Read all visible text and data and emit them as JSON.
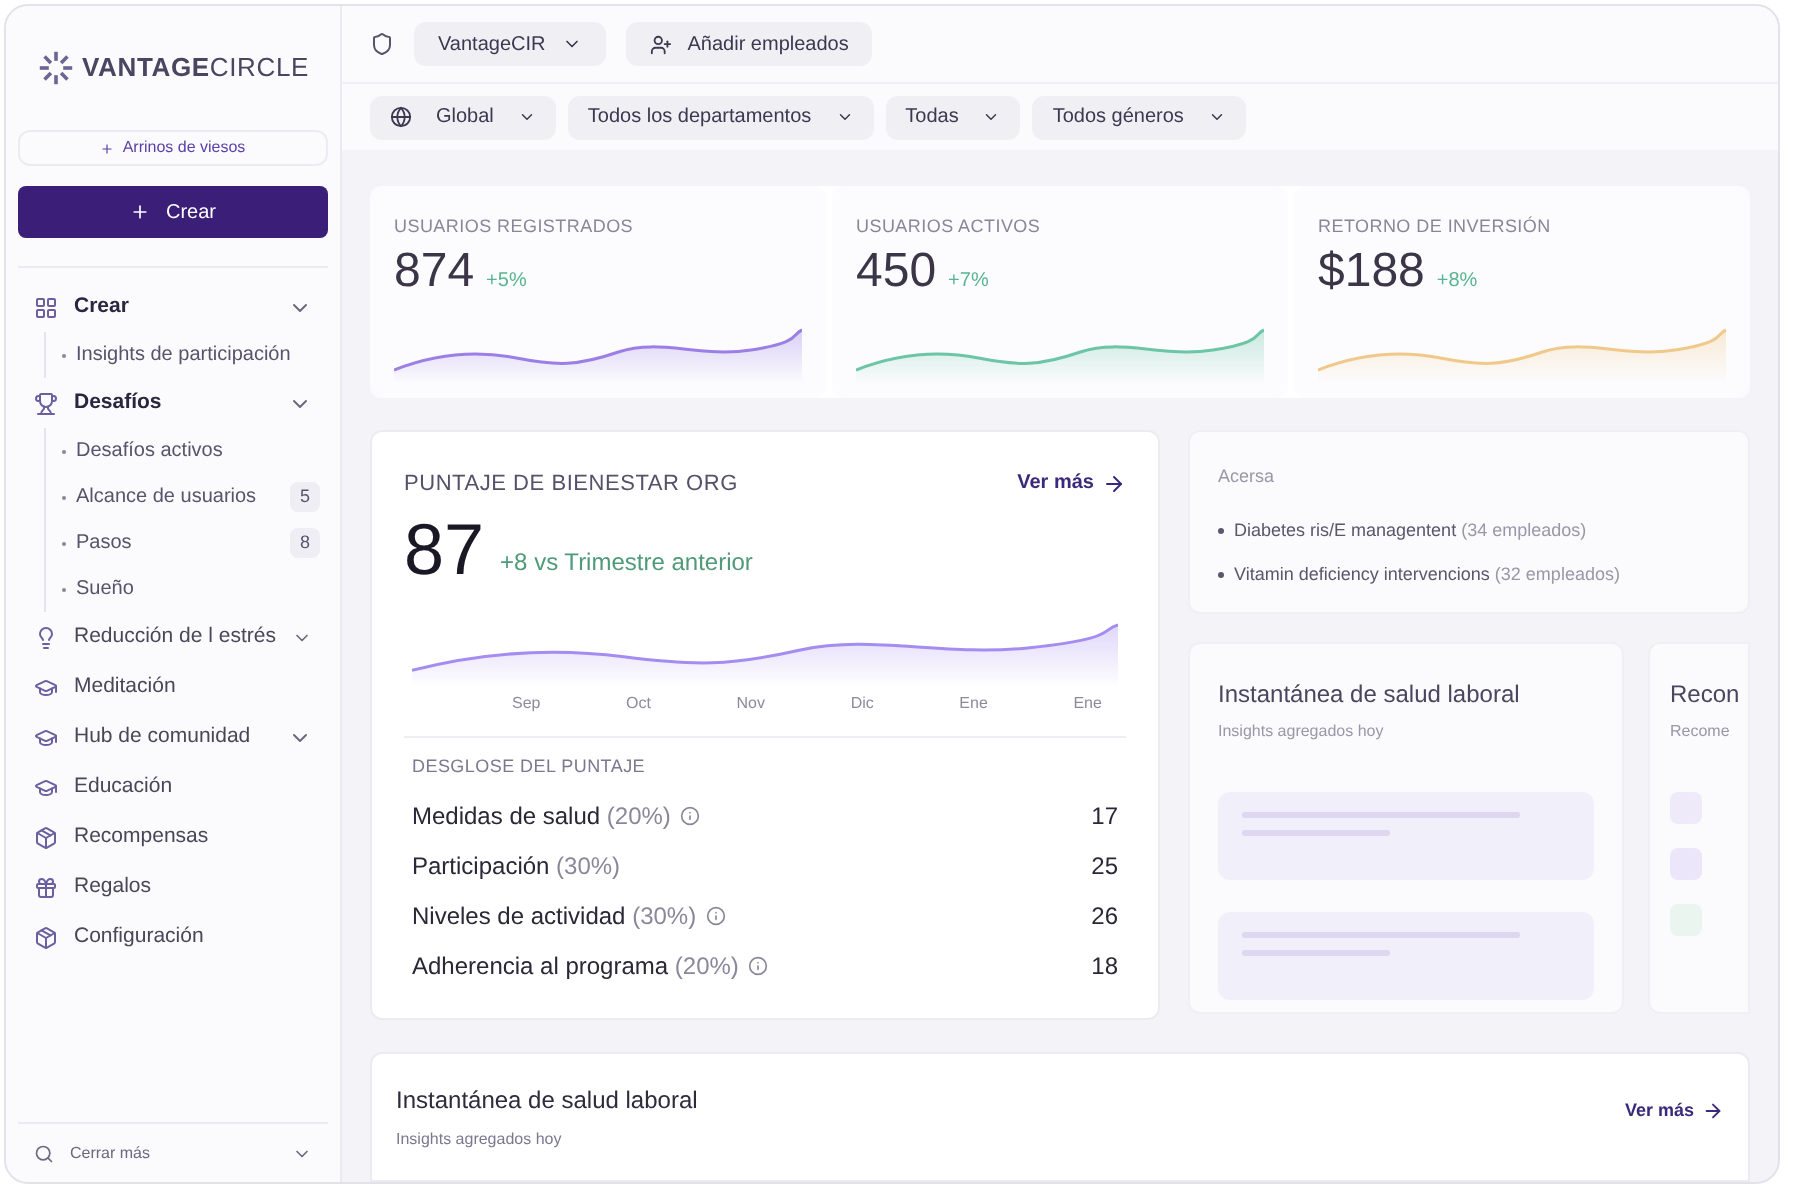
{
  "brand": {
    "name": "VANTAGE",
    "name_light": "CIRCLE"
  },
  "sidebar": {
    "top_link": "Arrinos de viesos",
    "create_button": "Crear",
    "items": [
      {
        "label": "Crear",
        "kind": "group",
        "children": [
          {
            "label": "Insights de participación"
          }
        ]
      },
      {
        "label": "Desafíos",
        "kind": "group",
        "children": [
          {
            "label": "Desafíos activos"
          },
          {
            "label": "Alcance de usuarios",
            "count": "5"
          },
          {
            "label": "Pasos",
            "count": "8"
          },
          {
            "label": "Sueño"
          }
        ]
      },
      {
        "label": "Reducción de l estrés",
        "kind": "group"
      },
      {
        "label": "Meditación",
        "kind": "link"
      },
      {
        "label": "Hub de comunidad",
        "kind": "group"
      },
      {
        "label": "Educación",
        "kind": "link"
      },
      {
        "label": "Recompensas",
        "kind": "link"
      },
      {
        "label": "Regalos",
        "kind": "link"
      },
      {
        "label": "Configuración",
        "kind": "link"
      }
    ],
    "footer": "Cerrar más"
  },
  "topbar": {
    "org": "VantageCIR",
    "add_button": "Añadir empleados"
  },
  "filters": [
    {
      "label": "Global",
      "icon": true
    },
    {
      "label": "Todos los departamentos",
      "icon": false
    },
    {
      "label": "Todas",
      "icon": false
    },
    {
      "label": "Todos géneros",
      "icon": false
    }
  ],
  "stats": [
    {
      "label": "USUARIOS REGISTRADOS",
      "value": "874",
      "change": "+5%",
      "color": "#9b7fe6"
    },
    {
      "label": "USUARIOS ACTIVOS",
      "value": "450",
      "change": "+7%",
      "color": "#6cc5a4"
    },
    {
      "label": "RETORNO DE INVERSIÓN",
      "value": "$188",
      "change": "+8%",
      "color": "#f0c98a"
    }
  ],
  "score_card": {
    "title": "PUNTAJE DE BIENESTAR ORG",
    "link": "Ver más",
    "score": "87",
    "change": "+8 vs Trimestre anterior",
    "months": [
      "Sep",
      "Oct",
      "Nov",
      "Dic",
      "Ene",
      "Ene"
    ],
    "breakdown_title": "DESGLOSE DEL PUNTAJE",
    "rows": [
      {
        "name": "Medidas de salud",
        "share": "(20%)",
        "info": true,
        "value": "17"
      },
      {
        "name": "Participación",
        "share": "(30%)",
        "info": false,
        "value": "25"
      },
      {
        "name": "Niveles de actividad",
        "share": "(30%)",
        "info": true,
        "value": "26"
      },
      {
        "name": "Adherencia al programa",
        "share": "(20%)",
        "info": true,
        "value": "18"
      }
    ]
  },
  "risk_card": {
    "title": "Acersa",
    "items": [
      {
        "name": "Diabetes ris/E managentent",
        "count": "(34 empleados)"
      },
      {
        "name": "Vitamin deficiency intervencions",
        "count": "(32 empleados)"
      }
    ]
  },
  "snapshot_card": {
    "title": "Instantánea de salud laboral",
    "subtitle": "Insights agregados hoy"
  },
  "recommend_card": {
    "title": "Recon",
    "subtitle": "Recome"
  },
  "bottom_card": {
    "title": "Instantánea de salud laboral",
    "subtitle": "Insights agregados hoy",
    "link": "Ver más"
  }
}
